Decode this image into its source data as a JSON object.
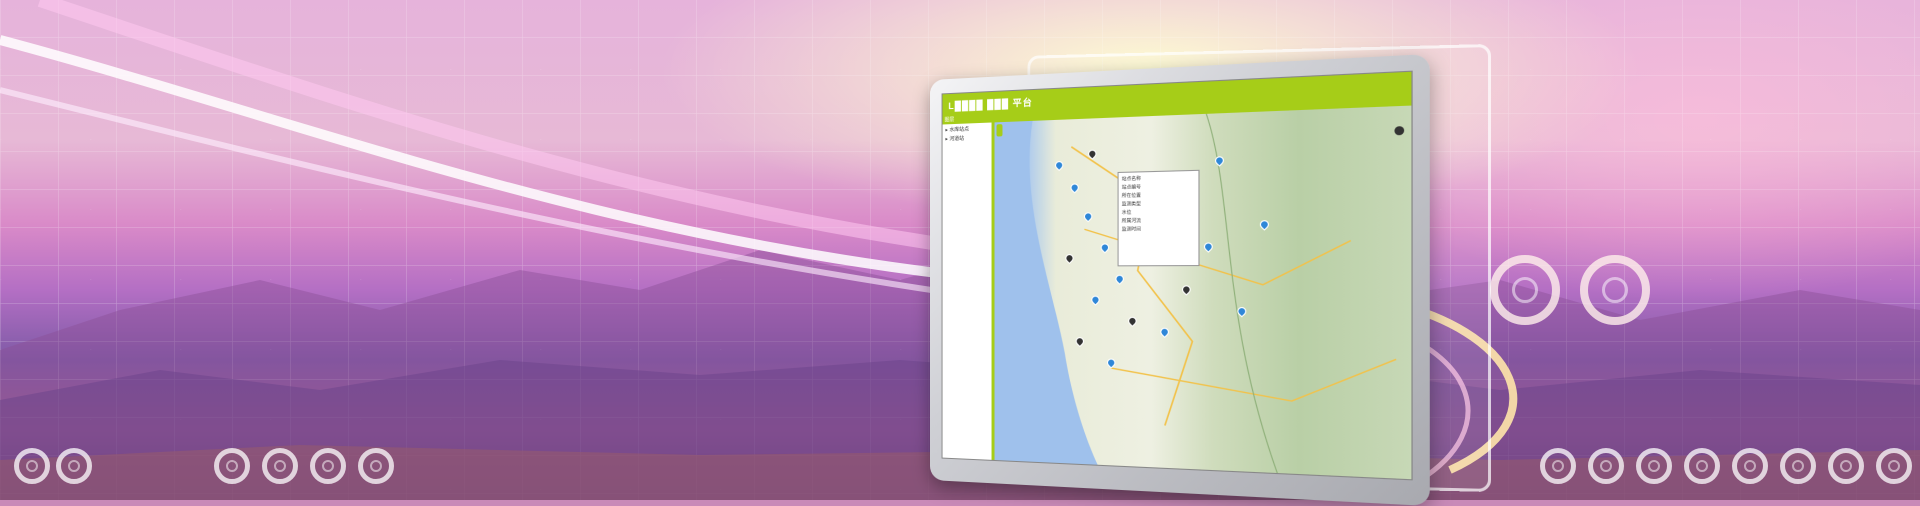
{
  "app": {
    "title": "L████ ███ 平台"
  },
  "sidebar": {
    "header": "图层",
    "items": [
      {
        "label": "▸ 水库站点"
      },
      {
        "label": "▸ 河道站"
      }
    ]
  },
  "popup": {
    "lines": [
      "站点名称",
      "站点编号",
      "所在位置",
      "监测类型",
      "水位",
      "所属河流",
      "监测时间"
    ]
  },
  "icons": {
    "zoom": "zoom-control-icon",
    "layers": "layers-icon"
  },
  "colors": {
    "accent": "#a6cd18",
    "map_water": "#a7c7ef",
    "marker": "#2f87d8"
  }
}
